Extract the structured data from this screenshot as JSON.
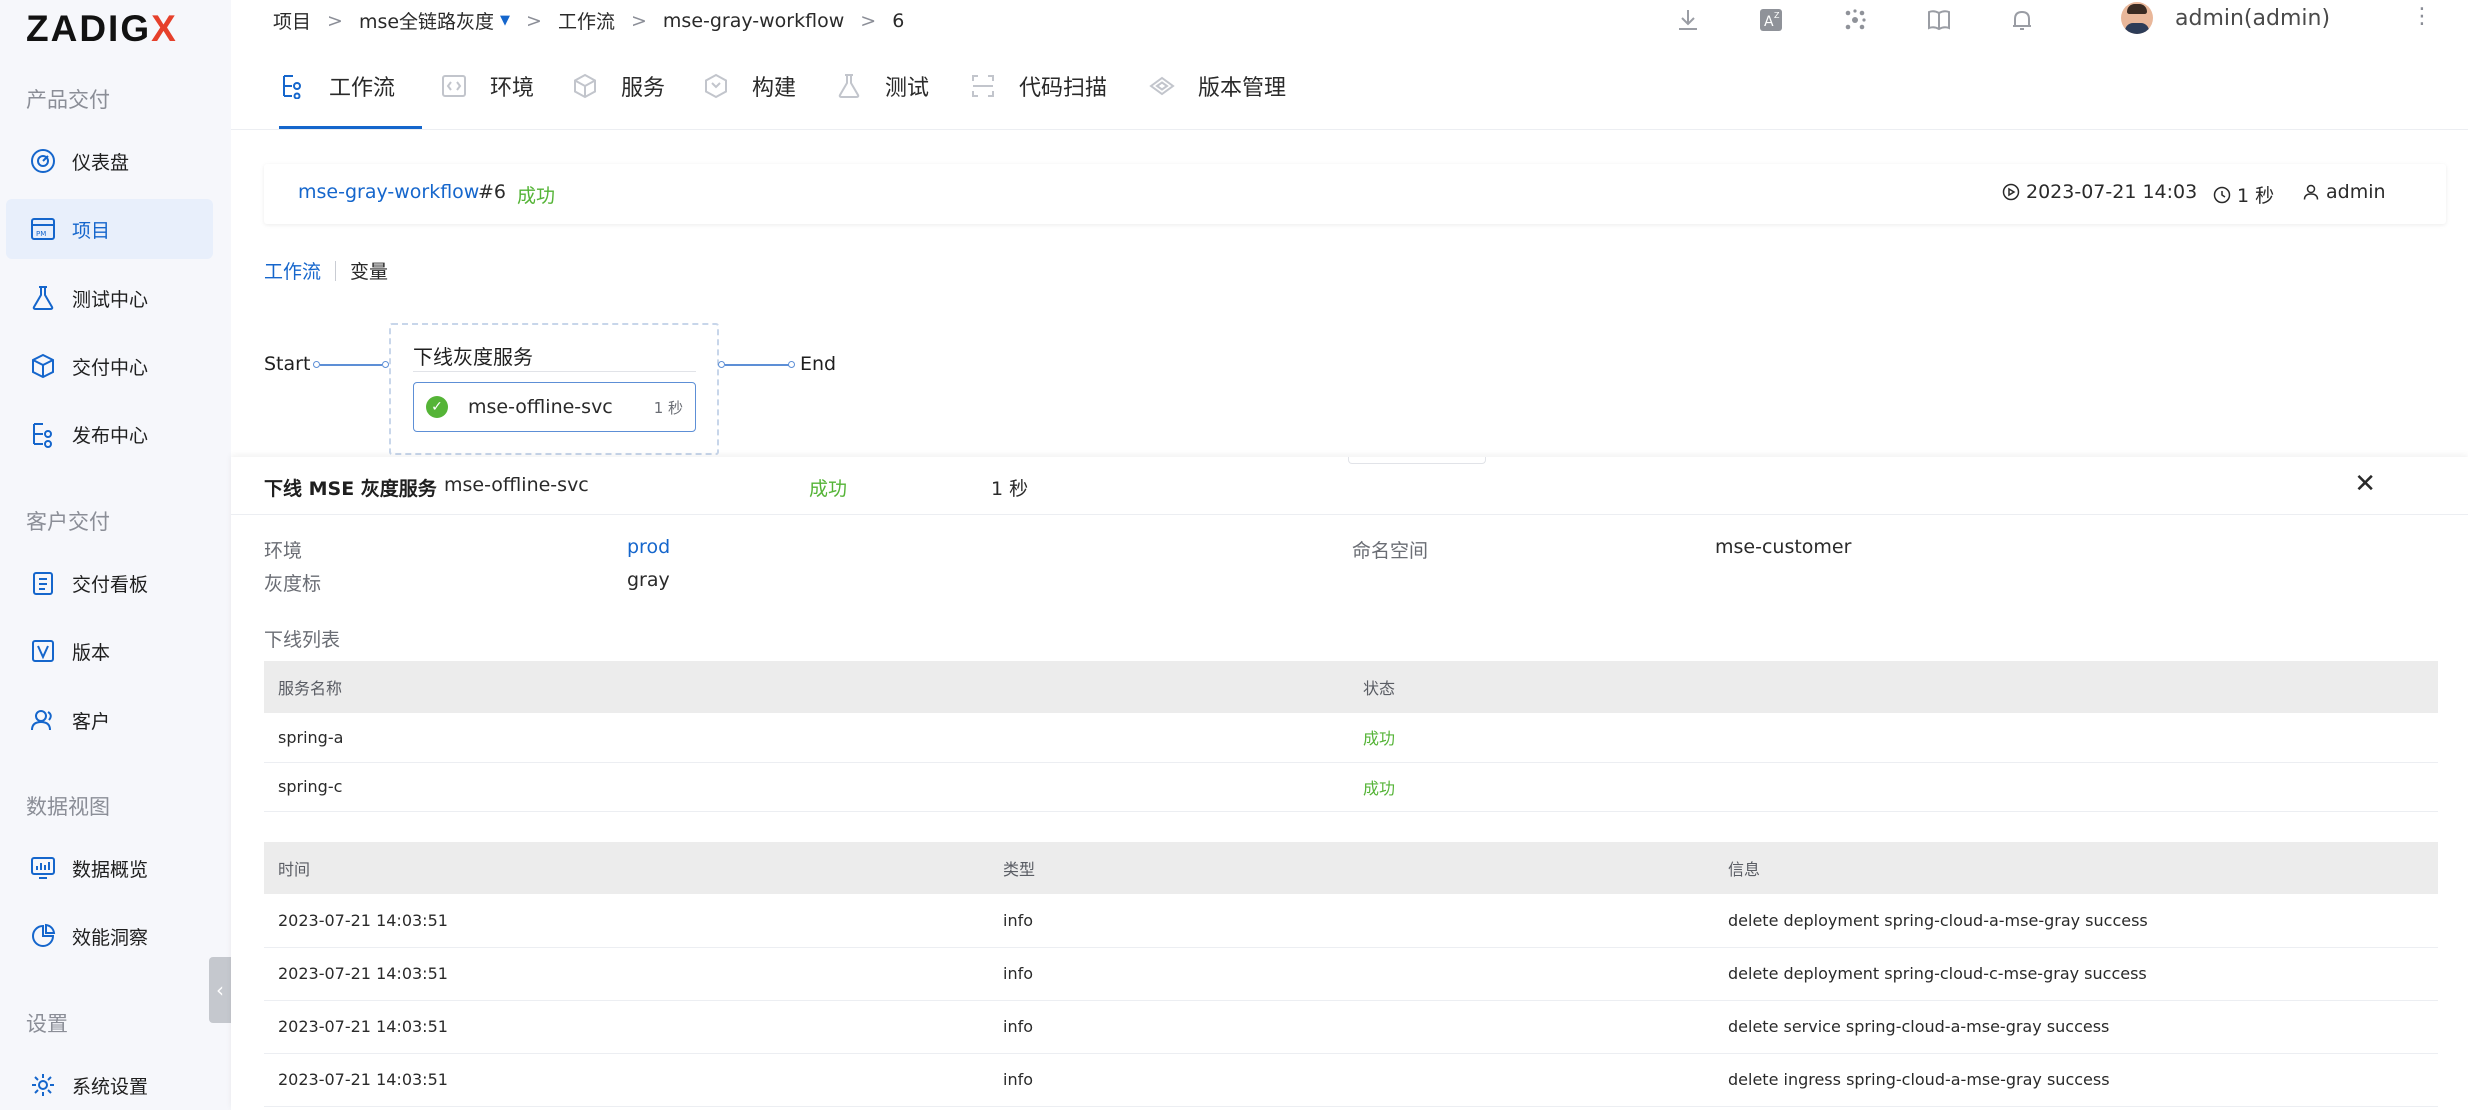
{
  "brand": {
    "logo_main": "ZADIG",
    "logo_x": "X"
  },
  "sidebar": {
    "sections": [
      {
        "title": "产品交付",
        "items": [
          {
            "label": "仪表盘",
            "icon": "dashboard-icon"
          },
          {
            "label": "项目",
            "icon": "project-icon",
            "active": true
          },
          {
            "label": "测试中心",
            "icon": "test-center-icon"
          },
          {
            "label": "交付中心",
            "icon": "delivery-center-icon"
          },
          {
            "label": "发布中心",
            "icon": "release-center-icon"
          }
        ]
      },
      {
        "title": "客户交付",
        "items": [
          {
            "label": "交付看板",
            "icon": "delivery-board-icon"
          },
          {
            "label": "版本",
            "icon": "version-icon"
          },
          {
            "label": "客户",
            "icon": "customer-icon"
          }
        ]
      },
      {
        "title": "数据视图",
        "items": [
          {
            "label": "数据概览",
            "icon": "data-overview-icon"
          },
          {
            "label": "效能洞察",
            "icon": "insight-icon"
          }
        ]
      },
      {
        "title": "设置",
        "items": [
          {
            "label": "系统设置",
            "icon": "gear-icon"
          }
        ]
      }
    ]
  },
  "breadcrumb": {
    "items": [
      "项目",
      "mse全链路灰度",
      "工作流",
      "mse-gray-workflow",
      "6"
    ],
    "separator": ">"
  },
  "user": {
    "name": "admin(admin)"
  },
  "top_icons": [
    "download-icon",
    "translate-icon",
    "plugin-icon",
    "docs-icon",
    "bell-icon"
  ],
  "tabs": [
    {
      "label": "工作流",
      "icon": "workflow-icon",
      "active": true
    },
    {
      "label": "环境",
      "icon": "environment-icon"
    },
    {
      "label": "服务",
      "icon": "service-icon"
    },
    {
      "label": "构建",
      "icon": "build-icon"
    },
    {
      "label": "测试",
      "icon": "test-icon"
    },
    {
      "label": "代码扫描",
      "icon": "scan-icon"
    },
    {
      "label": "版本管理",
      "icon": "version-manage-icon"
    }
  ],
  "run": {
    "workflow": "mse-gray-workflow",
    "number": "#6",
    "status": "成功",
    "started": "2023-07-21 14:03",
    "duration": "1 秒",
    "creator": "admin"
  },
  "subtabs": {
    "workflow": "工作流",
    "variables": "变量"
  },
  "pipeline": {
    "start": "Start",
    "end": "End",
    "stage_title": "下线灰度服务",
    "job": {
      "name": "mse-offline-svc",
      "time": "1 秒",
      "status": "success"
    }
  },
  "detail": {
    "title": "下线 MSE 灰度服务",
    "service": "mse-offline-svc",
    "status": "成功",
    "duration": "1 秒",
    "env_label": "环境",
    "env_value": "prod",
    "ns_label": "命名空间",
    "ns_value": "mse-customer",
    "tag_label": "灰度标",
    "tag_value": "gray",
    "list_label": "下线列表",
    "offline_table": {
      "headers": [
        "服务名称",
        "状态"
      ],
      "rows": [
        [
          "spring-a",
          "成功"
        ],
        [
          "spring-c",
          "成功"
        ]
      ]
    },
    "log_table": {
      "headers": [
        "时间",
        "类型",
        "信息"
      ],
      "rows": [
        [
          "2023-07-21 14:03:51",
          "info",
          "delete deployment spring-cloud-a-mse-gray success"
        ],
        [
          "2023-07-21 14:03:51",
          "info",
          "delete deployment spring-cloud-c-mse-gray success"
        ],
        [
          "2023-07-21 14:03:51",
          "info",
          "delete service spring-cloud-a-mse-gray success"
        ],
        [
          "2023-07-21 14:03:51",
          "info",
          "delete ingress spring-cloud-a-mse-gray success"
        ]
      ]
    }
  },
  "colors": {
    "accent": "#1566cc",
    "success": "#55b437",
    "brand_x": "#e6402b"
  }
}
